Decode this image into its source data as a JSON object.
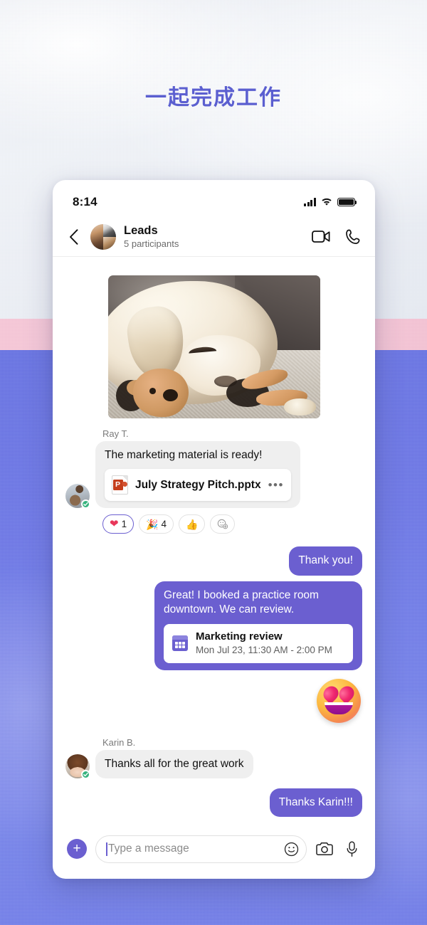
{
  "headline": "一起完成工作",
  "colors": {
    "accent_purple": "#6b5fd0",
    "headline_purple": "#5b5fd0",
    "bg_pink": "#f4c3d4",
    "bg_blue": "#6b74e4",
    "online_green": "#36b37e",
    "powerpoint_red": "#c43e1c",
    "heart_red": "#e8365a"
  },
  "status_bar": {
    "time": "8:14",
    "icons": [
      "cellular-signal-icon",
      "wifi-icon",
      "battery-icon"
    ]
  },
  "chat_header": {
    "back_icon": "chevron-left-icon",
    "avatar": "group-avatar",
    "title": "Leads",
    "subtitle": "5 participants",
    "actions": [
      {
        "name": "video-call-button",
        "icon": "video-camera-icon"
      },
      {
        "name": "audio-call-button",
        "icon": "phone-icon"
      }
    ]
  },
  "messages": {
    "photo": {
      "name": "shared-photo",
      "alt": "Sleeping cream Labrador dog resting head on a brown plush toy"
    },
    "ray": {
      "sender": "Ray T.",
      "text": "The marketing material is ready!",
      "file": {
        "icon": "powerpoint-file-icon",
        "name": "July Strategy Pitch.pptx",
        "menu": "•••"
      },
      "reactions": [
        {
          "emoji": "❤",
          "icon": "heart-reaction-icon",
          "count": "1",
          "active": true
        },
        {
          "emoji": "🎉",
          "icon": "celebrate-reaction-icon",
          "count": "4",
          "active": false
        },
        {
          "emoji": "👍",
          "icon": "thumbs-up-reaction-icon",
          "count": "",
          "active": false
        },
        {
          "emoji": "",
          "icon": "add-reaction-icon",
          "count": "",
          "active": false
        }
      ]
    },
    "thank_you": "Thank you!",
    "practice_room": {
      "text": "Great! I booked a practice room downtown. We can review.",
      "event": {
        "icon": "calendar-icon",
        "title": "Marketing review",
        "time": "Mon Jul 23, 11:30 AM - 2:00 PM"
      }
    },
    "sticker": {
      "name": "heart-eyes-emoji-sticker",
      "emoji": "😍"
    },
    "karin": {
      "sender": "Karin B.",
      "text": "Thanks all for the great work"
    },
    "thanks_karin": "Thanks Karin!!!"
  },
  "composer": {
    "add_button": "+",
    "placeholder": "Type a message",
    "input_value": "",
    "emoji_icon": "smiley-face-icon",
    "camera_icon": "camera-icon",
    "mic_icon": "microphone-icon"
  }
}
